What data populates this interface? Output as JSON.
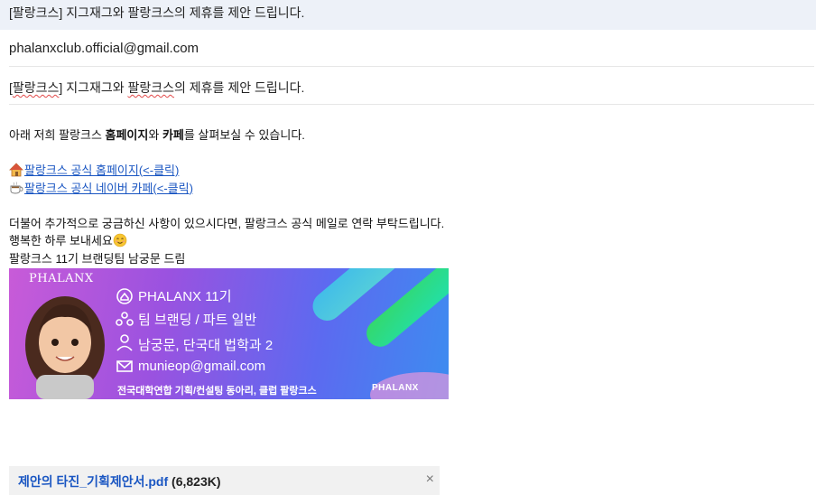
{
  "header": {
    "subject": "[팔랑크스] 지그재그와 팔랑크스의 제휴를 제안 드립니다."
  },
  "message": {
    "from": "phalanxclub.official@gmail.com",
    "subject_prefix": "[",
    "subject_brand": "팔랑크스",
    "subject_mid": "] 지그재그와 ",
    "subject_brand2": "팔랑크스",
    "subject_rest": "의 제휴를 제안 드립니다."
  },
  "body": {
    "line1_a": "아래 저희 팔랑크스 ",
    "line1_b": "홈페이지",
    "line1_c": "와 ",
    "line1_d": "카페",
    "line1_e": "를 살펴보실 수 있습니다.",
    "link_home": "팔랑크스 공식 홈페이지(<-클릭)",
    "link_cafe": "팔랑크스 공식 네이버 카페(<-클릭)",
    "line3": "더불어 추가적으로 궁금하신 사항이 있으시다면, 팔랑크스 공식 메일로 연락 부탁드립니다.",
    "line4": "행복한 하루 보내세요",
    "line5": "팔랑크스 11기 브랜딩팀 남궁문 드림"
  },
  "banner": {
    "brand": "PHALANX",
    "line1": "PHALANX 11기",
    "line2": "팀 브랜딩 / 파트 일반",
    "line3": "남궁문, 단국대 법학과 2",
    "line4": "munieop@gmail.com",
    "footer": "전국대학연합 기획/컨설팅 동아리, 클럽 팔랑크스",
    "brand_small": "PHALANX"
  },
  "attachment": {
    "name": "제안의 타진_기획제안서.pdf",
    "size": "(6,823K)",
    "close": "×"
  },
  "colors": {
    "link": "#1a56c2",
    "subject_bg": "#edf1f8",
    "attachment_bg": "#f1f1f1"
  }
}
